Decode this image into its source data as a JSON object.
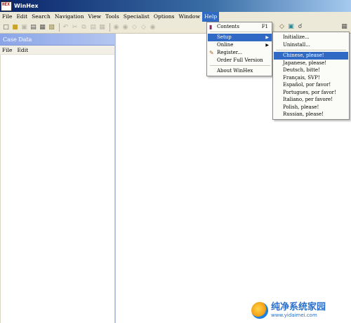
{
  "window": {
    "title": "WinHex",
    "app_icon_text": "HEX"
  },
  "menubar": {
    "items": [
      {
        "label": "File"
      },
      {
        "label": "Edit"
      },
      {
        "label": "Search"
      },
      {
        "label": "Navigation"
      },
      {
        "label": "View"
      },
      {
        "label": "Tools"
      },
      {
        "label": "Specialist"
      },
      {
        "label": "Options"
      },
      {
        "label": "Window"
      },
      {
        "label": "Help"
      }
    ]
  },
  "toolbar": {
    "icons": [
      "new-file-icon",
      "open-folder-icon",
      "save-icon",
      "print-icon",
      "properties-icon",
      "open-disk-icon",
      "undo-icon",
      "cut-icon",
      "copy-icon",
      "paste-icon",
      "paste-special-icon",
      "find-icon",
      "find-hex-icon",
      "replace-icon",
      "replace-hex-icon",
      "find-next-icon"
    ],
    "right_icons": [
      "disk-editor-icon",
      "ram-editor-icon",
      "search-disk-icon",
      "calculator-icon",
      "back-arrow-icon",
      "forward-arrow-icon"
    ]
  },
  "case_panel": {
    "title": "Case Data",
    "menu": {
      "file_label": "File",
      "edit_label": "Edit"
    }
  },
  "help_menu": {
    "items": [
      {
        "label": "Contents",
        "shortcut": "F1",
        "icon": "help-book-icon"
      },
      {
        "label": "Setup",
        "submenu": true,
        "selected": true
      },
      {
        "label": "Online",
        "submenu": true
      },
      {
        "label": "Register...",
        "icon": "register-icon"
      },
      {
        "label": "Order Full Version"
      },
      {
        "label": "About WinHex"
      }
    ]
  },
  "setup_menu": {
    "items": [
      {
        "label": "Initialize..."
      },
      {
        "label": "Uninstall..."
      },
      {
        "label": "Chinese, please!",
        "selected": true
      },
      {
        "label": "Japanese, please!"
      },
      {
        "label": "Deutsch, bitte!"
      },
      {
        "label": "Français, SVP!"
      },
      {
        "label": "Español, por favor!"
      },
      {
        "label": "Portugues, por favor!"
      },
      {
        "label": "Italiano, per favore!"
      },
      {
        "label": "Polish, please!"
      },
      {
        "label": "Russian, please!"
      }
    ]
  },
  "watermark": {
    "title": "纯净系统家园",
    "url": "www.yidaimei.com"
  },
  "colors": {
    "selection": "#316ac5",
    "menubar_bg": "#ece9d8",
    "title_bar": "#0a246a",
    "case_header": "#8aa5e8"
  }
}
